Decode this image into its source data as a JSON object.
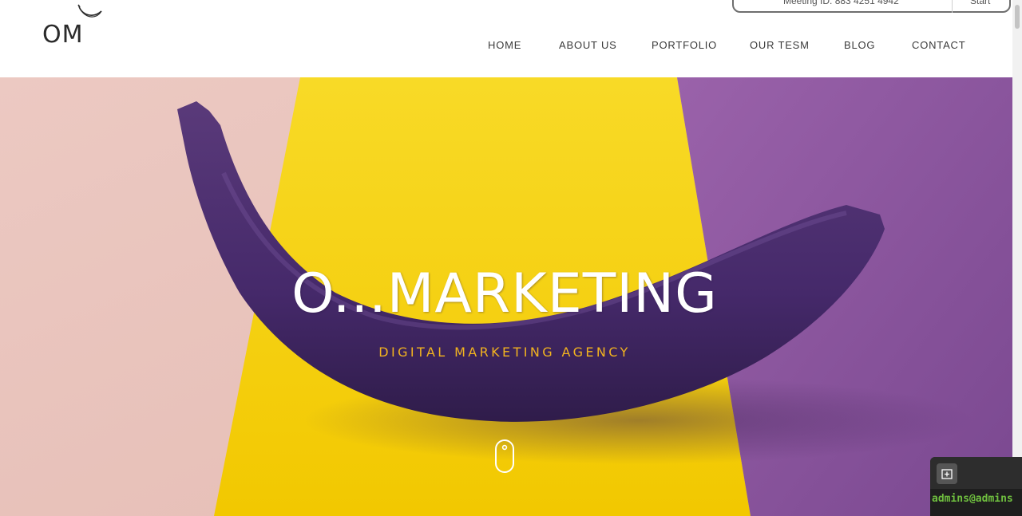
{
  "header": {
    "logo_text": "OM",
    "nav": {
      "home": "HOME",
      "about": "ABOUT US",
      "portfolio": "PORTFOLIO",
      "team": "OUR TESM",
      "blog": "BLOG",
      "contact": "CONTACT"
    }
  },
  "meeting_widget": {
    "meeting_id": "Meeting ID: 883 4251 4942",
    "start_label": "Start"
  },
  "hero": {
    "title": "O...MARKETING",
    "subtitle": "DIGITAL MARKETING AGENCY",
    "scroll_icon": "mouse-scroll-icon"
  },
  "terminal": {
    "new_tab_icon": "new-tab-icon",
    "prompt": "admins@admins"
  },
  "colors": {
    "subtitle_accent": "#f2b31f",
    "bg_pink": "#e8c6bf",
    "bg_yellow": "#f7d51c",
    "bg_purple": "#8a55a0",
    "banana": "#4a2d6a",
    "terminal_green": "#6fbf3f"
  }
}
